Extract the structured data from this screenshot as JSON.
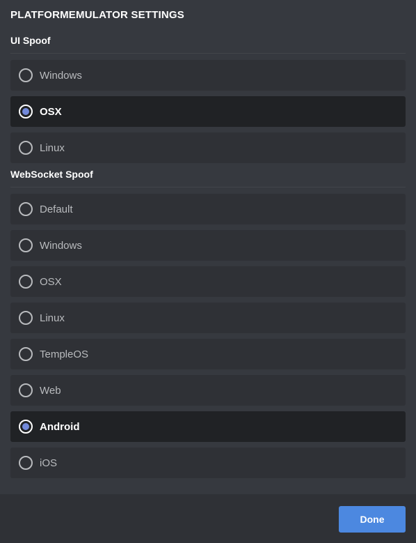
{
  "modal": {
    "title": "PLATFORMEMULATOR SETTINGS",
    "done_label": "Done"
  },
  "colors": {
    "background": "#36393f",
    "item_bg": "#2f3136",
    "selected_bg": "#202225",
    "accent": "#7289da",
    "button": "#4c88e0"
  },
  "ui_spoof": {
    "title": "UI Spoof",
    "options": [
      {
        "label": "Windows",
        "selected": false
      },
      {
        "label": "OSX",
        "selected": true
      },
      {
        "label": "Linux",
        "selected": false
      }
    ]
  },
  "websocket_spoof": {
    "title": "WebSocket Spoof",
    "options": [
      {
        "label": "Default",
        "selected": false
      },
      {
        "label": "Windows",
        "selected": false
      },
      {
        "label": "OSX",
        "selected": false
      },
      {
        "label": "Linux",
        "selected": false
      },
      {
        "label": "TempleOS",
        "selected": false
      },
      {
        "label": "Web",
        "selected": false
      },
      {
        "label": "Android",
        "selected": true
      },
      {
        "label": "iOS",
        "selected": false
      }
    ]
  }
}
